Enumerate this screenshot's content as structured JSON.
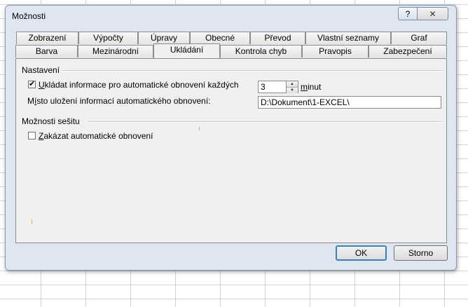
{
  "dialog": {
    "title": "Možnosti",
    "help_label": "?",
    "close_label": "✕"
  },
  "tabs": {
    "row1": [
      "Zobrazení",
      "Výpočty",
      "Úpravy",
      "Obecné",
      "Převod",
      "Vlastní seznamy",
      "Graf"
    ],
    "row2": [
      "Barva",
      "Mezinárodní",
      "Ukládání",
      "Kontrola chyb",
      "Pravopis",
      "Zabezpečení"
    ],
    "active": "Ukládání"
  },
  "settings": {
    "group_label": "Nastavení",
    "autosave": {
      "checked": true,
      "check_glyph": "✔",
      "label_underlined": "U",
      "label_rest": "kládat informace pro automatické obnovení každých"
    },
    "minutes": {
      "value": "3",
      "unit_underlined": "m",
      "unit_rest": "inut",
      "up": "▲",
      "down": "▼"
    },
    "location": {
      "label_pre": "M",
      "label_underlined": "í",
      "label_rest": "sto uložení informací automatického obnovení:",
      "value": "D:\\Dokument\\1-EXCEL\\"
    }
  },
  "workbook": {
    "group_label": "Možnosti sešitu",
    "disable_autorecover": {
      "checked": false,
      "label_underlined": "Z",
      "label_rest": "akázat automatické obnovení"
    }
  },
  "buttons": {
    "ok": "OK",
    "cancel": "Storno"
  }
}
